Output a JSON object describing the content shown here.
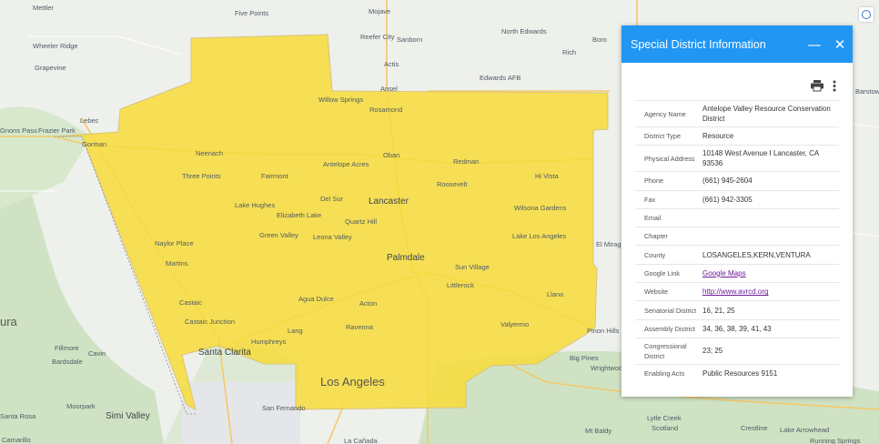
{
  "panel": {
    "title": "Special District Information",
    "minimize_icon": "minus-icon",
    "close_icon": "close-icon",
    "print_icon": "printer-icon",
    "more_icon": "more-vertical-icon",
    "rows": [
      {
        "label": "Agency Name",
        "value": "Antelope Valley Resource Conservation District"
      },
      {
        "label": "District Type",
        "value": "Resource"
      },
      {
        "label": "Physical Address",
        "value": "10148 West Avenue I Lancaster, CA 93536"
      },
      {
        "label": "Phone",
        "value": "(661) 945-2604"
      },
      {
        "label": "Fax",
        "value": "(661) 942-3305"
      },
      {
        "label": "Email",
        "value": ""
      },
      {
        "label": "Chapter",
        "value": ""
      },
      {
        "label": "County",
        "value": "LOSANGELES,KERN,VENTURA"
      },
      {
        "label": "Google Link",
        "value": "Google Maps"
      },
      {
        "label": "Website",
        "value": "http://www.avrcd.org"
      },
      {
        "label": "Senatorial District",
        "value": "16, 21, 25"
      },
      {
        "label": "Assembly District",
        "value": "34, 36, 38, 39, 41, 43"
      },
      {
        "label": "Congressional District",
        "value": "23; 25"
      },
      {
        "label": "Enabling Acts",
        "value": "Public Resources 9151"
      }
    ]
  },
  "map": {
    "district_fill": "#f7dc3a",
    "places": [
      "Mettler",
      "Five Points",
      "Mojave",
      "Reefer City",
      "Sanborn",
      "North Edwards",
      "Boro",
      "Wheeler Ridge",
      "Grapevine",
      "Rich",
      "Actis",
      "Edwards AFB",
      "Ansel",
      "Willow Springs",
      "Rosamond",
      "Barstow",
      "Lebec",
      "Frazier Park",
      "Gorman",
      "Neenach",
      "Oban",
      "Redman",
      "Antelope Acres",
      "Fairmont",
      "Three Points",
      "Hi Vista",
      "Del Sur",
      "Lancaster",
      "Roosevelt",
      "Lake Hughes",
      "Elizabeth Lake",
      "Quartz Hill",
      "Wilsona Gardens",
      "Green Valley",
      "Leona Valley",
      "Lake Los Angeles",
      "Naylor Place",
      "El Mirage",
      "Palmdale",
      "Sun Village",
      "Martins",
      "Littlerock",
      "Castaic",
      "Agua Dulce",
      "Acton",
      "Llano",
      "Castaic Junction",
      "Ravenna",
      "Valyermo",
      "Pinon Hills",
      "Fillmore",
      "Humphreys",
      "Lang",
      "Bardsdale",
      "Cavin",
      "Santa Clarita",
      "Big Pines",
      "Wrightwood",
      "Los Angeles",
      "San Fernando",
      "Moorpark",
      "Simi Valley",
      "Lytle Creek",
      "Scotland",
      "Mt Baldy",
      "Crestline",
      "Lake Arrowhead",
      "Camarillo",
      "La Cañada",
      "Running Springs",
      "Gnons Pass",
      "Santa Rosa",
      "ura"
    ]
  }
}
